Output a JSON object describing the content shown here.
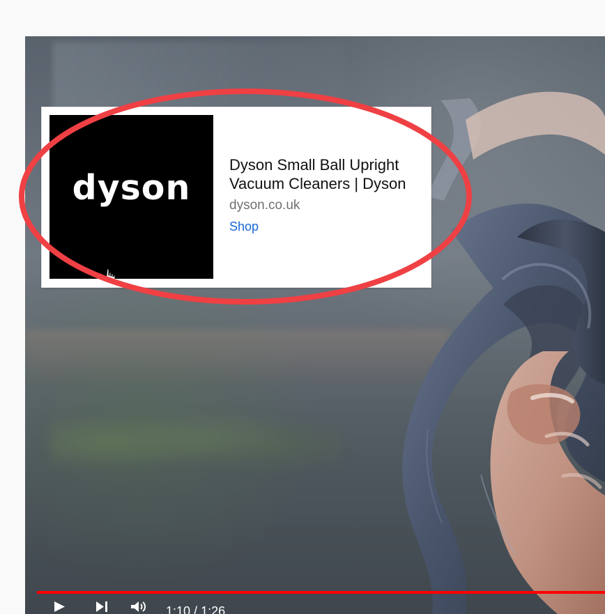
{
  "ad": {
    "brand": "dyson",
    "title": "Dyson Small Ball Upright\nVacuum Cleaners | Dyson",
    "domain": "dyson.co.uk",
    "cta": "Shop"
  },
  "player": {
    "current_time": "1:10",
    "separator": " / ",
    "duration": "1:26",
    "progress_percent": 100
  },
  "colors": {
    "progress": "#ff0000",
    "link": "#1668d5",
    "highlight": "#ef4044"
  },
  "icons": {
    "play": "play-icon",
    "next": "next-icon",
    "volume": "volume-icon",
    "cursor": "hand-cursor-icon"
  }
}
